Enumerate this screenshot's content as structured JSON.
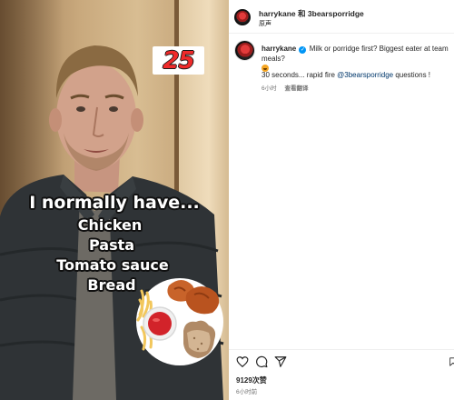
{
  "post": {
    "username": "harrykane",
    "and_word": "和",
    "collaborator": "3bearsporridge",
    "audio_label": "原声",
    "caption": {
      "username": "harrykane",
      "text": "Milk or porridge first? Biggest eater at team meals?",
      "line2_prefix": "30 seconds... rapid fire ",
      "mention": "@3bearsporridge",
      "line2_suffix": " questions !",
      "time": "6小时",
      "translate": "查看翻译"
    },
    "likes": "9129次赞",
    "time_ago": "6小时前"
  },
  "video": {
    "badge_number": "25",
    "caption_heading": "I normally have...",
    "caption_items": [
      "Chicken",
      "Pasta",
      "Tomato sauce",
      "Bread"
    ]
  },
  "icons": {
    "like": "heart-icon",
    "comment": "comment-icon",
    "share": "share-icon",
    "save": "bookmark-icon"
  },
  "colors": {
    "verified": "#0095f6",
    "badge_number": "#ef2b2b",
    "mention": "#00376b"
  }
}
